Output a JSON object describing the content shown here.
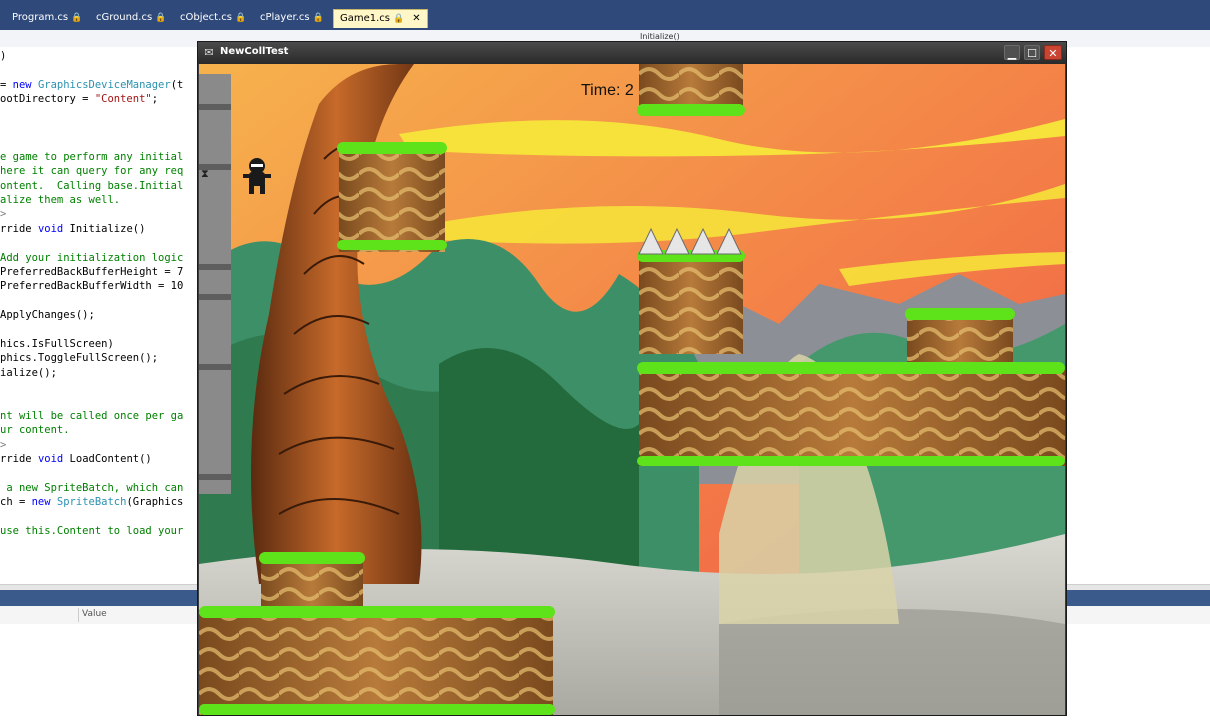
{
  "ide": {
    "tabs": [
      {
        "label": "Program.cs",
        "pin": "🔒"
      },
      {
        "label": "cGround.cs",
        "pin": "🔒"
      },
      {
        "label": "cObject.cs",
        "pin": "🔒"
      },
      {
        "label": "cPlayer.cs",
        "pin": "🔒"
      },
      {
        "label": "Game1.cs",
        "pin": "🔒",
        "close": "✕"
      }
    ],
    "nav_method": "Initialize()",
    "watch_columns": {
      "value": "Value"
    }
  },
  "code": [
    {
      "text": ")",
      "kind": "plain"
    },
    {
      "text": "",
      "kind": "plain"
    },
    {
      "text": "= new GraphicsDeviceManager(t",
      "kind": "mixed1"
    },
    {
      "text": "ootDirectory = \"Content\";",
      "kind": "mixed2"
    },
    {
      "text": "",
      "kind": "plain"
    },
    {
      "text": "",
      "kind": "plain"
    },
    {
      "text": "",
      "kind": "plain"
    },
    {
      "text": "e game to perform any initial",
      "kind": "comment"
    },
    {
      "text": "here it can query for any req",
      "kind": "comment"
    },
    {
      "text": "ontent.  Calling base.Initial",
      "kind": "comment"
    },
    {
      "text": "alize them as well.",
      "kind": "comment"
    },
    {
      "text": ">",
      "kind": "gray"
    },
    {
      "text": "rride void Initialize()",
      "kind": "mixed3"
    },
    {
      "text": "",
      "kind": "plain"
    },
    {
      "text": "Add your initialization logic",
      "kind": "comment"
    },
    {
      "text": "PreferredBackBufferHeight = 7",
      "kind": "plain"
    },
    {
      "text": "PreferredBackBufferWidth = 10",
      "kind": "plain"
    },
    {
      "text": "",
      "kind": "plain"
    },
    {
      "text": "ApplyChanges();",
      "kind": "plain"
    },
    {
      "text": "",
      "kind": "plain"
    },
    {
      "text": "hics.IsFullScreen)",
      "kind": "plain"
    },
    {
      "text": "phics.ToggleFullScreen();",
      "kind": "plain"
    },
    {
      "text": "ialize();",
      "kind": "plain"
    },
    {
      "text": "",
      "kind": "plain"
    },
    {
      "text": "",
      "kind": "plain"
    },
    {
      "text": "nt will be called once per ga",
      "kind": "comment"
    },
    {
      "text": "ur content.",
      "kind": "comment"
    },
    {
      "text": ">",
      "kind": "gray"
    },
    {
      "text": "rride void LoadContent()",
      "kind": "mixed3"
    },
    {
      "text": "",
      "kind": "plain"
    },
    {
      "text": " a new SpriteBatch, which can",
      "kind": "comment"
    },
    {
      "text": "ch = new SpriteBatch(Graphics",
      "kind": "mixed4"
    },
    {
      "text": "",
      "kind": "plain"
    },
    {
      "text": "use this.Content to load your",
      "kind": "comment"
    }
  ],
  "game": {
    "title": "NewCollTest",
    "hud_time": "Time: 2",
    "buttons": {
      "minimize": "▁",
      "maximize": "☐",
      "close": "✕"
    },
    "colors": {
      "sky_top": "#f4a24a",
      "sky_bottom": "#f05a46",
      "grass": "#5ee21a",
      "dirt": "#a0642a",
      "jungle": "#3f8f60",
      "ground": "#c9c9c0"
    }
  }
}
